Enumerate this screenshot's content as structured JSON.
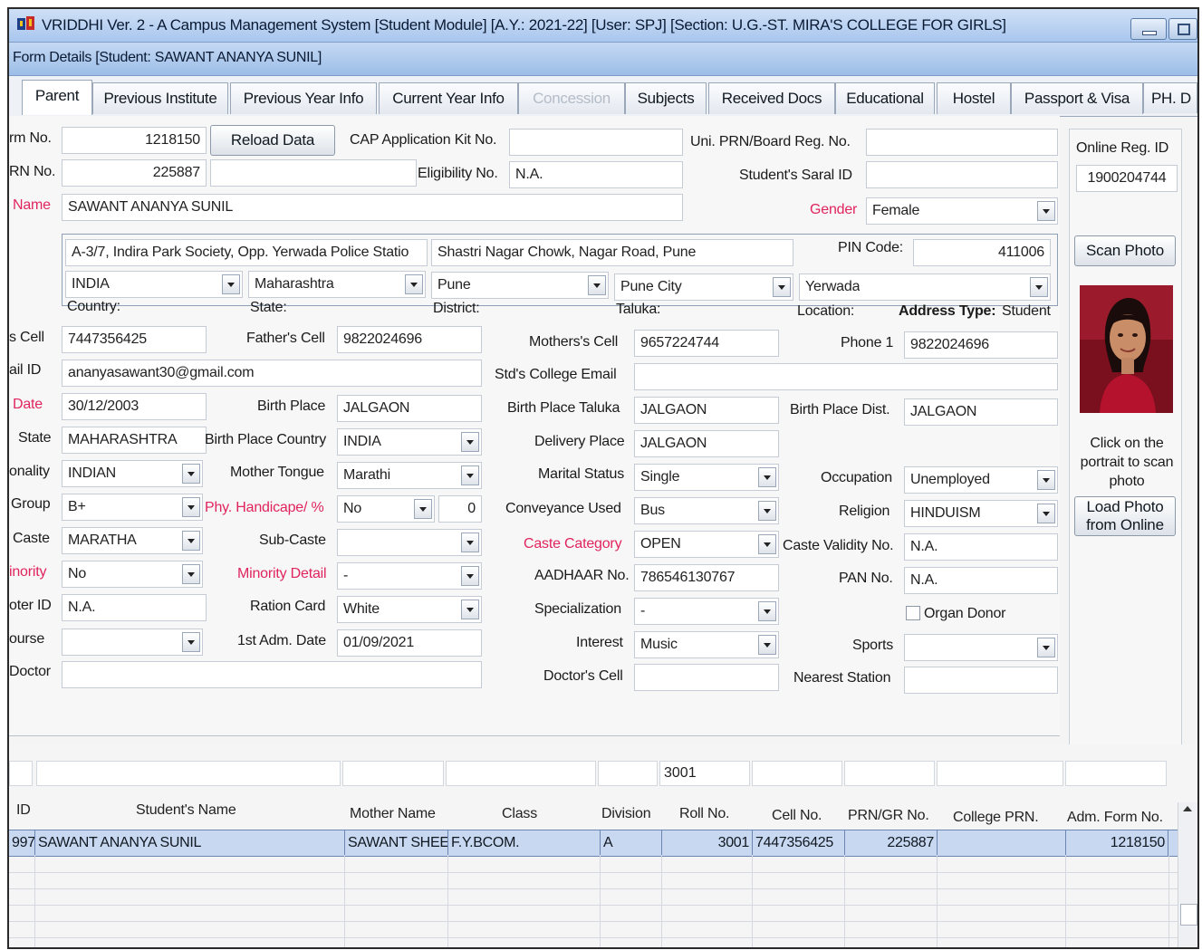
{
  "window": {
    "title": "VRIDDHI Ver. 2 - A Campus Management System [Student Module] [A.Y.: 2021-22] [User: SPJ] [Section: U.G.-ST. MIRA'S COLLEGE FOR GIRLS]",
    "form_title": "Form Details [Student: SAWANT ANANYA SUNIL]"
  },
  "tabs": [
    "Parent",
    "Previous Institute",
    "Previous Year Info",
    "Current Year Info",
    "Concession",
    "Subjects",
    "Received Docs",
    "Educational",
    "Hostel",
    "Passport & Visa",
    "PH. D"
  ],
  "form": {
    "form_no_label": "rm No.",
    "form_no": "1218150",
    "reload_button": "Reload Data",
    "cap_label": "CAP Application Kit No.",
    "cap_value": "",
    "uni_prn_label": "Uni. PRN/Board Reg. No.",
    "uni_prn_value": "",
    "online_reg_label": "Online Reg. ID",
    "online_reg_value": "1900204744",
    "grn_label": "RN No.",
    "grn_value": "225887",
    "eligibility_label": "Eligibility No.",
    "eligibility_value": "N.A.",
    "saral_label": "Student's Saral ID",
    "saral_value": "",
    "name_label": "Name",
    "name_value": "SAWANT ANANYA SUNIL",
    "gender_label": "Gender",
    "gender_value": "Female",
    "address1": "A-3/7, Indira Park Society, Opp. Yerwada Police Statio",
    "address2": "Shastri Nagar Chowk, Nagar Road, Pune",
    "pin_label": "PIN Code:",
    "pin_value": "411006",
    "country_value": "INDIA",
    "state_value": "Maharashtra",
    "district_value": "Pune",
    "taluka_value": "Pune City",
    "location_value": "Yerwada",
    "country_label": "Country:",
    "state_label": "State:",
    "district_label": "District:",
    "taluka_label": "Taluka:",
    "location_label": "Location:",
    "address_type_label": "Address Type:",
    "address_type_value": "Student",
    "cell_label": "s Cell",
    "cell_value": "7447356425",
    "father_cell_label": "Father's Cell",
    "father_cell_value": "9822024696",
    "mother_cell_label": "Mothers's Cell",
    "mother_cell_value": "9657224744",
    "phone1_label": "Phone 1",
    "phone1_value": "9822024696",
    "email_label": "ail ID",
    "email_value": "ananyasawant30@gmail.com",
    "college_email_label": "Std's College Email",
    "college_email_value": "",
    "birth_date_label": "Date",
    "birth_date_value": "30/12/2003",
    "birth_place_label": "Birth Place",
    "birth_place_value": "JALGAON",
    "bp_taluka_label": "Birth Place Taluka",
    "bp_taluka_value": "JALGAON",
    "bp_dist_label": "Birth Place Dist.",
    "bp_dist_value": "JALGAON",
    "state2_label": "State",
    "state2_value": "MAHARASHTRA",
    "bp_country_label": "Birth Place Country",
    "bp_country_value": "INDIA",
    "delivery_label": "Delivery Place",
    "delivery_value": "JALGAON",
    "nationality_label": "onality",
    "nationality_value": "INDIAN",
    "mother_tongue_label": "Mother Tongue",
    "mother_tongue_value": "Marathi",
    "marital_label": "Marital Status",
    "marital_value": "Single",
    "occupation_label": "Occupation",
    "occupation_value": "Unemployed",
    "blood_label": "Group",
    "blood_value": "B+",
    "handicap_label": "Phy. Handicape/ %",
    "handicap_value": "No",
    "handicap_percent": "0",
    "conveyance_label": "Conveyance Used",
    "conveyance_value": "Bus",
    "religion_label": "Religion",
    "religion_value": "HINDUISM",
    "caste_label": "Caste",
    "caste_value": "MARATHA",
    "subcaste_label": "Sub-Caste",
    "subcaste_value": "",
    "caste_cat_label": "Caste Category",
    "caste_cat_value": "OPEN",
    "caste_validity_label": "Caste Validity No.",
    "caste_validity_value": "N.A.",
    "minority_label": "inority",
    "minority_value": "No",
    "minority_detail_label": "Minority Detail",
    "minority_detail_value": "-",
    "aadhaar_label": "AADHAAR No.",
    "aadhaar_value": "786546130767",
    "pan_label": "PAN No.",
    "pan_value": "N.A.",
    "voter_label": "oter ID",
    "voter_value": "N.A.",
    "ration_label": "Ration Card",
    "ration_value": "White",
    "specialization_label": "Specialization",
    "specialization_value": "-",
    "organ_donor_label": "Organ Donor",
    "course_label": "ourse",
    "course_value": "",
    "first_adm_label": "1st Adm. Date",
    "first_adm_value": "01/09/2021",
    "interest_label": "Interest",
    "interest_value": "Music",
    "sports_label": "Sports",
    "sports_value": "",
    "doctor_label": "Doctor",
    "doctor_value": "",
    "doctor_cell_label": "Doctor's Cell",
    "doctor_cell_value": "",
    "nearest_station_label": "Nearest Station",
    "nearest_station_value": ""
  },
  "side": {
    "scan_button": "Scan Photo",
    "hint": [
      "Click on the",
      "portrait to scan",
      "photo"
    ],
    "load_button": [
      "Load Photo",
      "from Online"
    ]
  },
  "grid": {
    "filter_rollno": "3001",
    "headers": [
      "ID",
      "Student's Name",
      "Mother Name",
      "Class",
      "Division",
      "Roll No.",
      "Cell No.",
      "PRN/GR No.",
      "College PRN.",
      "Adm. Form No."
    ],
    "row": {
      "id": "997",
      "name": "SAWANT ANANYA SUNIL",
      "mother": "SAWANT SHEE",
      "class": "F.Y.BCOM.",
      "division": "A",
      "roll": "3001",
      "cell": "7447356425",
      "prn": "225887",
      "college_prn": "",
      "form_no": "1218150"
    }
  }
}
